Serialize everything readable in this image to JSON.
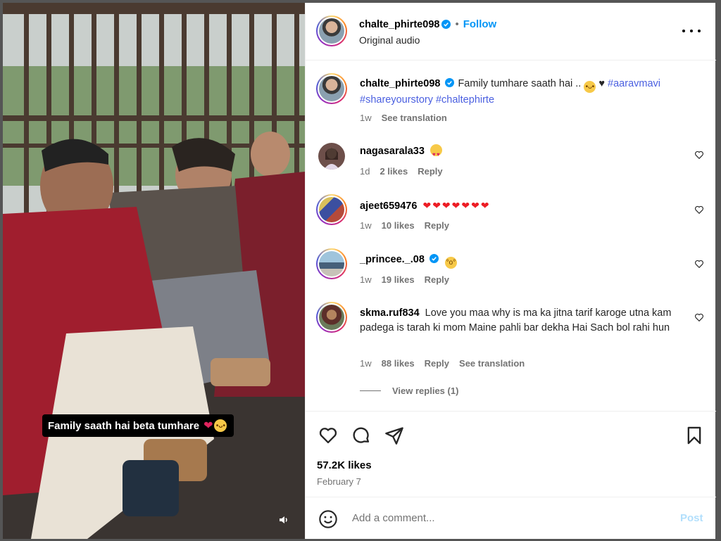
{
  "post": {
    "username": "chalte_phirte098",
    "follow_label": "Follow",
    "audio": "Original audio",
    "video_caption": "Family saath hai beta tumhare"
  },
  "caption": {
    "username": "chalte_phirte098",
    "text": "Family tumhare saath hai ..",
    "tags_line1": "#aaravmavi",
    "tags_line2": "#shareyourstory #chaltephirte",
    "age": "1w",
    "see_translation": "See translation"
  },
  "comments": [
    {
      "username": "nagasarala33",
      "text": "",
      "age": "1d",
      "likes": "2 likes",
      "reply": "Reply"
    },
    {
      "username": "ajeet659476",
      "text": "",
      "age": "1w",
      "likes": "10 likes",
      "reply": "Reply"
    },
    {
      "username": "_princee._.08",
      "text": "",
      "age": "1w",
      "likes": "19 likes",
      "reply": "Reply"
    },
    {
      "username": "skma.ruf834",
      "text": "Love you maa why is ma ka jitna tarif karoge utna kam padega is tarah ki mom Maine pahli bar dekha Hai Sach bol rahi hun",
      "age": "1w",
      "likes": "88 likes",
      "reply": "Reply",
      "see_translation": "See translation",
      "view_replies": "View replies (1)"
    }
  ],
  "footer": {
    "likes": "57.2K likes",
    "date": "February 7",
    "comment_placeholder": "Add a comment...",
    "post_label": "Post"
  },
  "colors": {
    "accent": "#0095f6",
    "hashtag": "#4a5fe0",
    "muted": "#737373",
    "post_disabled": "#b2dffc"
  },
  "icons": [
    "verified-badge-icon",
    "more-options-icon",
    "heart-icon",
    "comment-icon",
    "share-icon",
    "bookmark-icon",
    "emoji-icon",
    "volume-icon"
  ]
}
